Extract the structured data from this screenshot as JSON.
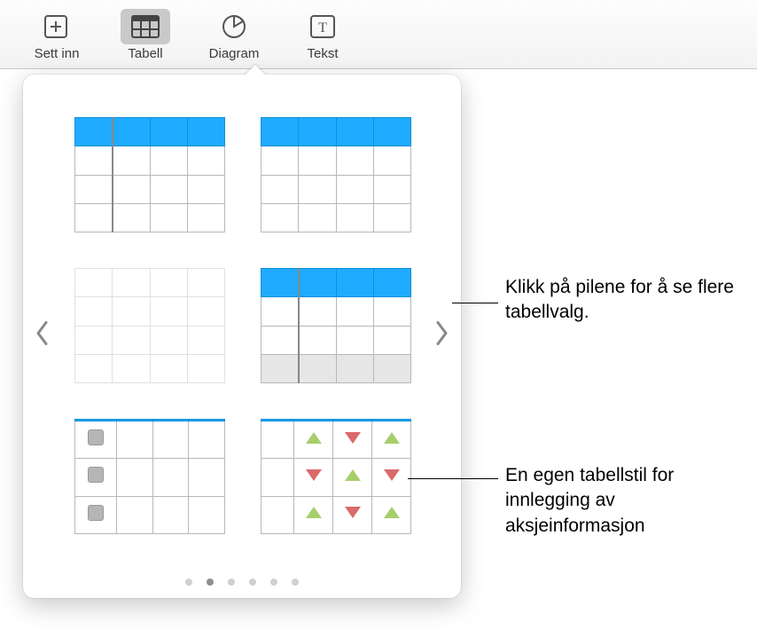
{
  "toolbar": {
    "items": [
      {
        "label": "Sett inn",
        "icon": "insert-plus-icon"
      },
      {
        "label": "Tabell",
        "icon": "table-icon",
        "active": true
      },
      {
        "label": "Diagram",
        "icon": "pie-chart-icon"
      },
      {
        "label": "Tekst",
        "icon": "text-box-icon"
      }
    ]
  },
  "popover": {
    "page_count": 6,
    "active_page_index": 1,
    "styles": [
      {
        "name": "blue-header-accent-col"
      },
      {
        "name": "blue-header-plain"
      },
      {
        "name": "plain-no-header"
      },
      {
        "name": "blue-header-footer"
      },
      {
        "name": "blue-header-checkboxes"
      },
      {
        "name": "blue-header-stock-triangles"
      }
    ]
  },
  "callouts": {
    "arrow": "Klikk på pilene for å se flere tabellvalg.",
    "stock": "En egen tabellstil for innlegging av aksjeinformasjon"
  },
  "colors": {
    "accent_blue": "#1fabff",
    "up_green": "#a6cf6a",
    "down_red": "#d96a6a"
  }
}
